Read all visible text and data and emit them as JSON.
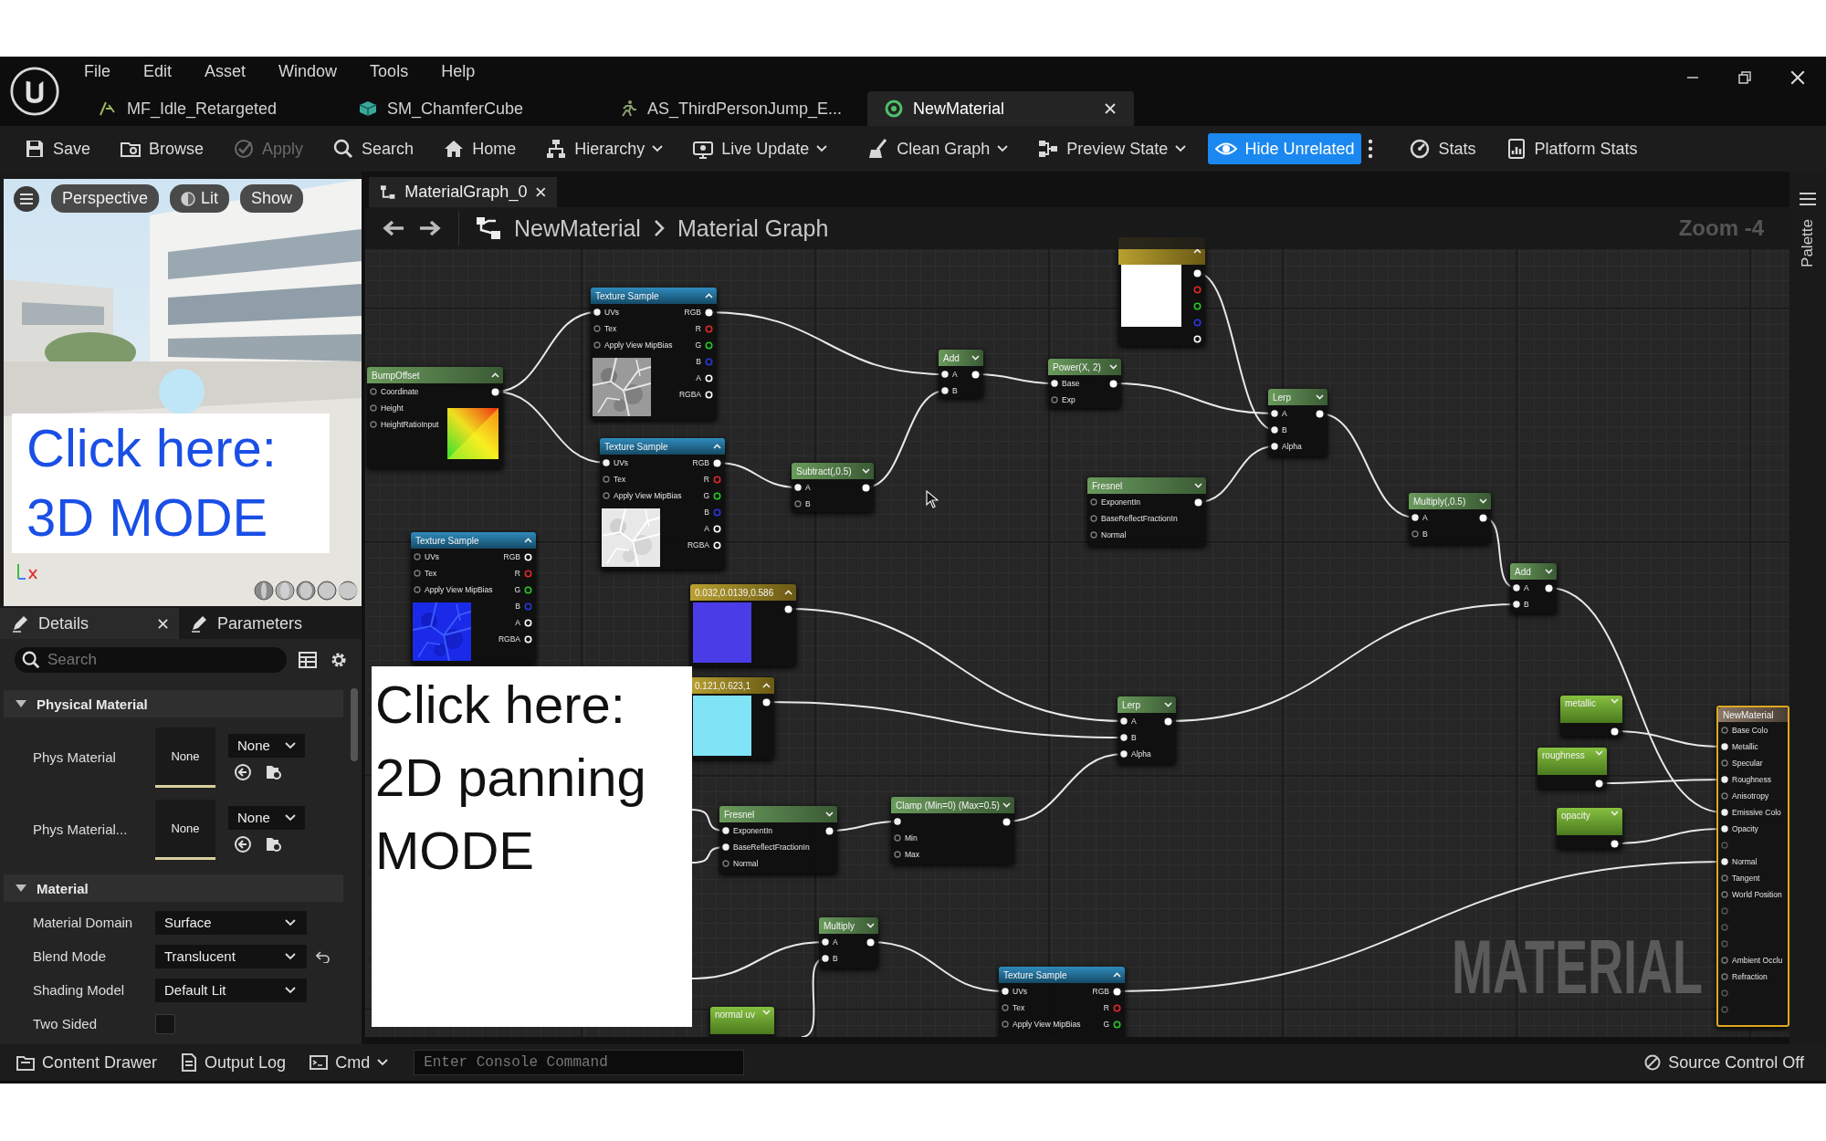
{
  "menu": [
    "File",
    "Edit",
    "Asset",
    "Window",
    "Tools",
    "Help"
  ],
  "tabs": [
    {
      "label": "MF_Idle_Retargeted",
      "selected": false
    },
    {
      "label": "SM_ChamferCube",
      "selected": false
    },
    {
      "label": "AS_ThirdPersonJump_E...",
      "selected": false
    },
    {
      "label": "NewMaterial",
      "selected": true
    }
  ],
  "toolbar": [
    {
      "label": "Save",
      "dropdown": false,
      "disabled": false,
      "selected": false
    },
    {
      "label": "Browse",
      "dropdown": false,
      "disabled": false,
      "selected": false
    },
    {
      "label": "Apply",
      "dropdown": false,
      "disabled": true,
      "selected": false
    },
    {
      "label": "Search",
      "dropdown": false,
      "disabled": false,
      "selected": false
    },
    {
      "label": "Home",
      "dropdown": false,
      "disabled": false,
      "selected": false
    },
    {
      "label": "Hierarchy",
      "dropdown": true,
      "disabled": false,
      "selected": false
    },
    {
      "label": "Live Update",
      "dropdown": true,
      "disabled": false,
      "selected": false
    },
    {
      "label": "Clean Graph",
      "dropdown": true,
      "disabled": false,
      "selected": false
    },
    {
      "label": "Preview State",
      "dropdown": true,
      "disabled": false,
      "selected": false
    },
    {
      "label": "Hide Unrelated",
      "dropdown": false,
      "disabled": false,
      "selected": true
    },
    {
      "label": "Stats",
      "dropdown": false,
      "disabled": false,
      "selected": false
    },
    {
      "label": "Platform Stats",
      "dropdown": false,
      "disabled": false,
      "selected": false
    }
  ],
  "viewport": {
    "buttons": [
      {
        "label": "Perspective"
      },
      {
        "label": "Lit"
      },
      {
        "label": "Show"
      }
    ],
    "note": "Click here:\n3D MODE"
  },
  "details": {
    "tabs": [
      {
        "label": "Details",
        "selected": true
      },
      {
        "label": "Parameters",
        "selected": false
      }
    ],
    "search_placeholder": "Search",
    "sections": [
      {
        "title": "Physical Material",
        "expanded": true,
        "rows": [
          {
            "kind": "asset",
            "label": "Phys Material",
            "thumb": "None",
            "value": "None"
          },
          {
            "kind": "asset",
            "label": "Phys Material...",
            "thumb": "None",
            "value": "None"
          }
        ]
      },
      {
        "title": "Material",
        "expanded": true,
        "rows": [
          {
            "kind": "dropdown",
            "label": "Material Domain",
            "value": "Surface",
            "modified": false
          },
          {
            "kind": "dropdown",
            "label": "Blend Mode",
            "value": "Translucent",
            "modified": true
          },
          {
            "kind": "dropdown",
            "label": "Shading Model",
            "value": "Default Lit",
            "modified": false
          },
          {
            "kind": "checkbox",
            "label": "Two Sided",
            "checked": false
          }
        ]
      }
    ]
  },
  "graph": {
    "tab": "MaterialGraph_0",
    "breadcrumb": [
      "NewMaterial",
      "Material Graph"
    ],
    "zoom": "Zoom -4",
    "palette": "Palette",
    "watermark": "MATERIAL",
    "note": "Click here:\n2D panning\nMODE",
    "nodes": [
      {
        "kind": "math",
        "title": "BumpOffset",
        "expanded": true,
        "rows": [
          {
            "in": "Coordinate",
            "in_linked": false,
            "out_linked": true,
            "color": "#ffffff"
          },
          {
            "in": "Height",
            "in_linked": false
          },
          {
            "in": "HeightRatioInput",
            "in_linked": false
          }
        ]
      },
      {
        "kind": "texture",
        "title": "Texture Sample",
        "expanded": true,
        "rows": [
          {
            "in": "UVs",
            "in_linked": true,
            "out": "RGB",
            "out_linked": true,
            "color": "#ffffff"
          },
          {
            "in": "Tex",
            "in_linked": false,
            "out": "R",
            "out_linked": false,
            "color": "#e02828"
          },
          {
            "in": "Apply View MipBias",
            "in_linked": false,
            "out": "G",
            "out_linked": false,
            "color": "#28c828"
          },
          {
            "out": "B",
            "out_linked": false,
            "color": "#2838e0"
          },
          {
            "out": "A",
            "out_linked": false,
            "color": "#ffffff"
          },
          {
            "out": "RGBA",
            "out_linked": false,
            "color": "#ffffff"
          }
        ]
      },
      {
        "kind": "texture",
        "title": "Texture Sample",
        "expanded": true,
        "rows": [
          {
            "in": "UVs",
            "in_linked": true,
            "out": "RGB",
            "out_linked": true,
            "color": "#ffffff"
          },
          {
            "in": "Tex",
            "in_linked": false,
            "out": "R",
            "out_linked": false,
            "color": "#e02828"
          },
          {
            "in": "Apply View MipBias",
            "in_linked": false,
            "out": "G",
            "out_linked": false,
            "color": "#28c828"
          },
          {
            "out": "B",
            "out_linked": false,
            "color": "#2838e0"
          },
          {
            "out": "A",
            "out_linked": false,
            "color": "#ffffff"
          },
          {
            "out": "RGBA",
            "out_linked": false,
            "color": "#ffffff"
          }
        ]
      },
      {
        "kind": "texture",
        "title": "Texture Sample",
        "expanded": true,
        "rows": [
          {
            "in": "UVs",
            "in_linked": false,
            "out": "RGB",
            "out_linked": false,
            "color": "#ffffff"
          },
          {
            "in": "Tex",
            "in_linked": false,
            "out": "R",
            "out_linked": false,
            "color": "#e02828"
          },
          {
            "in": "Apply View MipBias",
            "in_linked": false,
            "out": "G",
            "out_linked": false,
            "color": "#28c828"
          },
          {
            "out": "B",
            "out_linked": false,
            "color": "#2838e0"
          },
          {
            "out": "A",
            "out_linked": false,
            "color": "#ffffff"
          },
          {
            "out": "RGBA",
            "out_linked": false,
            "color": "#ffffff"
          }
        ]
      },
      {
        "kind": "constant",
        "title": "0.032,0.0139,0.586",
        "expanded": true,
        "color": "#4a3ce6",
        "rows": [
          {
            "out_linked": true,
            "color": "#ffffff"
          }
        ]
      },
      {
        "kind": "constant",
        "title": "0.121,0.623,1",
        "expanded": true,
        "color": "#80e4f6",
        "rows": [
          {
            "out_linked": true,
            "color": "#ffffff"
          }
        ]
      },
      {
        "kind": "math",
        "title": "Subtract(,0.5)",
        "expanded": false,
        "rows": [
          {
            "in": "A",
            "in_linked": true,
            "out_linked": true,
            "color": "#ffffff"
          },
          {
            "in": "B",
            "in_linked": false
          }
        ]
      },
      {
        "kind": "math",
        "title": "Add",
        "expanded": false,
        "rows": [
          {
            "in": "A",
            "in_linked": true,
            "out_linked": true,
            "color": "#ffffff"
          },
          {
            "in": "B",
            "in_linked": true
          }
        ]
      },
      {
        "kind": "math",
        "title": "Power(X, 2)",
        "expanded": false,
        "rows": [
          {
            "in": "Base",
            "in_linked": true,
            "out_linked": true,
            "color": "#ffffff"
          },
          {
            "in": "Exp",
            "in_linked": false
          }
        ]
      },
      {
        "kind": "vector",
        "expanded": true,
        "color": "#ffffff",
        "rows": [
          {
            "out_linked": true,
            "color": "#ffffff"
          },
          {
            "out_linked": false,
            "color": "#e02828"
          },
          {
            "out_linked": false,
            "color": "#28c828"
          },
          {
            "out_linked": false,
            "color": "#2838e0"
          },
          {
            "out_linked": false,
            "color": "#ffffff"
          }
        ]
      },
      {
        "kind": "math",
        "title": "Lerp",
        "expanded": false,
        "rows": [
          {
            "in": "A",
            "in_linked": true,
            "out_linked": true,
            "color": "#ffffff"
          },
          {
            "in": "B",
            "in_linked": true
          },
          {
            "in": "Alpha",
            "in_linked": true
          }
        ]
      },
      {
        "kind": "math",
        "title": "Fresnel",
        "expanded": false,
        "rows": [
          {
            "in": "ExponentIn",
            "in_linked": false,
            "out_linked": true,
            "color": "#ffffff"
          },
          {
            "in": "BaseReflectFractionIn",
            "in_linked": false
          },
          {
            "in": "Normal",
            "in_linked": false
          }
        ]
      },
      {
        "kind": "math",
        "title": "Multiply(,0.5)",
        "expanded": false,
        "rows": [
          {
            "in": "A",
            "in_linked": true,
            "out_linked": true,
            "color": "#ffffff"
          },
          {
            "in": "B",
            "in_linked": false
          }
        ]
      },
      {
        "kind": "math",
        "title": "Add",
        "expanded": false,
        "rows": [
          {
            "in": "A",
            "in_linked": true,
            "out_linked": true,
            "color": "#ffffff"
          },
          {
            "in": "B",
            "in_linked": true
          }
        ]
      },
      {
        "kind": "math",
        "title": "Lerp",
        "expanded": false,
        "rows": [
          {
            "in": "A",
            "in_linked": true,
            "out_linked": true,
            "color": "#ffffff"
          },
          {
            "in": "B",
            "in_linked": true
          },
          {
            "in": "Alpha",
            "in_linked": true
          }
        ]
      },
      {
        "kind": "math",
        "title": "Fresnel",
        "expanded": false,
        "rows": [
          {
            "in": "ExponentIn",
            "in_linked": true,
            "out_linked": true,
            "color": "#ffffff"
          },
          {
            "in": "BaseReflectFractionIn",
            "in_linked": true
          },
          {
            "in": "Normal",
            "in_linked": false
          }
        ]
      },
      {
        "kind": "math",
        "title": "Clamp (Min=0) (Max=0.5)",
        "expanded": false,
        "rows": [
          {
            "in_linked": true,
            "out_linked": true,
            "color": "#ffffff"
          },
          {
            "in": "Min",
            "in_linked": false
          },
          {
            "in": "Max",
            "in_linked": false
          }
        ]
      },
      {
        "kind": "math",
        "title": "Multiply",
        "expanded": false,
        "rows": [
          {
            "in": "A",
            "in_linked": true,
            "out_linked": true,
            "color": "#ffffff"
          },
          {
            "in": "B",
            "in_linked": true
          }
        ]
      },
      {
        "kind": "texture",
        "title": "Texture Sample",
        "expanded": true,
        "rows": [
          {
            "in": "UVs",
            "in_linked": true,
            "out": "RGB",
            "out_linked": true,
            "color": "#ffffff"
          },
          {
            "in": "Tex",
            "in_linked": false,
            "out": "R",
            "out_linked": false,
            "color": "#e02828"
          },
          {
            "in": "Apply View MipBias",
            "in_linked": false,
            "out": "G",
            "out_linked": false,
            "color": "#28c828"
          }
        ]
      },
      {
        "kind": "scalar",
        "title": "normal uv",
        "expanded": false
      },
      {
        "kind": "scalar",
        "title": "metallic",
        "expanded": false,
        "rows": [
          {
            "out_linked": true,
            "color": "#ffffff"
          }
        ]
      },
      {
        "kind": "scalar",
        "title": "roughness",
        "expanded": false,
        "rows": [
          {
            "out_linked": true,
            "color": "#ffffff"
          }
        ]
      },
      {
        "kind": "scalar",
        "title": "opacity",
        "expanded": false,
        "rows": [
          {
            "out_linked": true,
            "color": "#ffffff"
          }
        ]
      },
      {
        "kind": "result",
        "title": "NewMaterial",
        "rows": [
          {
            "in": "Base Colo",
            "in_linked": false,
            "faded": false
          },
          {
            "in": "Metallic",
            "in_linked": true,
            "faded": false
          },
          {
            "in": "Specular",
            "in_linked": false,
            "faded": false
          },
          {
            "in": "Roughness",
            "in_linked": true,
            "faded": false
          },
          {
            "in": "Anisotropy",
            "in_linked": false,
            "faded": false
          },
          {
            "in": "Emissive Colo",
            "in_linked": true,
            "faded": false
          },
          {
            "in": "Opacity",
            "in_linked": true,
            "faded": false
          },
          {
            "in_linked": false,
            "faded": true
          },
          {
            "in": "Normal",
            "in_linked": true,
            "faded": false
          },
          {
            "in": "Tangent",
            "in_linked": false,
            "faded": false
          },
          {
            "in": "World Position",
            "in_linked": false,
            "faded": false
          },
          {
            "in_linked": false,
            "faded": true
          },
          {
            "in_linked": false,
            "faded": true
          },
          {
            "in_linked": false,
            "faded": true
          },
          {
            "in": "Ambient Occlu",
            "in_linked": false,
            "faded": false
          },
          {
            "in": "Refraction",
            "in_linked": false,
            "faded": false
          },
          {
            "in_linked": false,
            "faded": true
          },
          {
            "in_linked": false,
            "faded": true
          }
        ]
      }
    ]
  },
  "status": {
    "buttons": [
      {
        "label": "Content Drawer",
        "dropdown": false
      },
      {
        "label": "Output Log",
        "dropdown": false
      },
      {
        "label": "Cmd",
        "dropdown": true
      }
    ],
    "console_placeholder": "Enter Console Command",
    "source_control": "Source Control Off"
  }
}
